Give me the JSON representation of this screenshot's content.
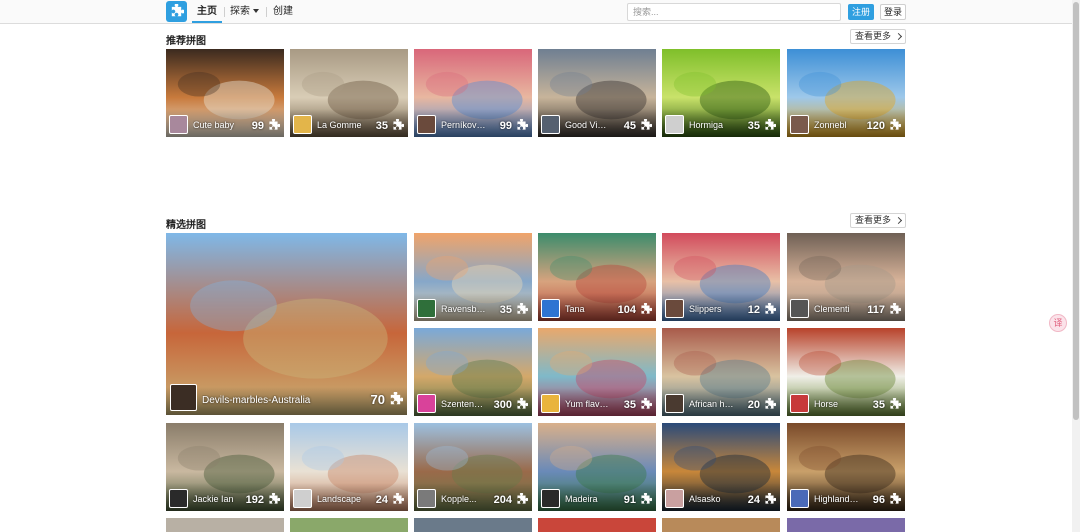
{
  "nav": {
    "home": "主页",
    "explore": "探索",
    "create": "创建",
    "search_placeholder": "搜索...",
    "register": "注册",
    "login": "登录"
  },
  "sections": {
    "recommended_title": "推荐拼图",
    "featured_title": "精选拼图",
    "more_label": "查看更多"
  },
  "recommended": [
    {
      "name": "Cute baby",
      "count": "99",
      "colors": [
        "#3b2a1f",
        "#c87a3c",
        "#e9e2d3"
      ],
      "avatar": "#a8889c"
    },
    {
      "name": "La Gomme",
      "count": "35",
      "colors": [
        "#a89a84",
        "#d9cdb6",
        "#6e5c45"
      ],
      "avatar": "#e3b54a"
    },
    {
      "name": "Perníková s",
      "count": "99",
      "colors": [
        "#d9677a",
        "#e8b7a0",
        "#5b8fd2"
      ],
      "avatar": "#6a4a3c"
    },
    {
      "name": "Good Vibes",
      "count": "45",
      "colors": [
        "#6f7f92",
        "#c7b49a",
        "#3a3430"
      ],
      "avatar": "#556070"
    },
    {
      "name": "Hormiga",
      "count": "35",
      "colors": [
        "#7fbf2a",
        "#c9e26a",
        "#2f5a12"
      ],
      "avatar": "#cfcfcf"
    },
    {
      "name": "Zonnebl",
      "count": "120",
      "colors": [
        "#3d8fd6",
        "#9ec8ea",
        "#e3a621"
      ],
      "avatar": "#7a5a4c"
    }
  ],
  "featured": [
    {
      "name": "Devils-marbles-Australia",
      "count": "70",
      "colors": [
        "#7fb8e8",
        "#c7663a",
        "#c9b377"
      ],
      "avatar": "#3b2d24"
    },
    {
      "name": "Ravensbur...",
      "count": "35",
      "colors": [
        "#f0a46a",
        "#86a7c9",
        "#e6d6b8"
      ],
      "avatar": "#2f6f3a"
    },
    {
      "name": "Tana",
      "count": "104",
      "colors": [
        "#3c8c6c",
        "#d7a37e",
        "#b94a3c"
      ],
      "avatar": "#2e74d2"
    },
    {
      "name": "Slippers",
      "count": "12",
      "colors": [
        "#d24b5c",
        "#e8c0a6",
        "#4a7fc0"
      ],
      "avatar": "#6a4a3c"
    },
    {
      "name": "Clementi",
      "count": "117",
      "colors": [
        "#6f6055",
        "#d9b49a",
        "#a7998a"
      ],
      "avatar": "#555555"
    },
    {
      "name": "Szentend...",
      "count": "300",
      "colors": [
        "#7aa9d9",
        "#d4a86a",
        "#5f7a4a"
      ],
      "avatar": "#d9429a"
    },
    {
      "name": "Yum flavour",
      "count": "35",
      "colors": [
        "#e9a86c",
        "#7fb9c9",
        "#c24a6a"
      ],
      "avatar": "#e9b43c"
    },
    {
      "name": "African ha...",
      "count": "20",
      "colors": [
        "#a85a4a",
        "#d9c3a0",
        "#5a7c8c"
      ],
      "avatar": "#4a3a30"
    },
    {
      "name": "Horse",
      "count": "35",
      "colors": [
        "#b8422a",
        "#f0efe8",
        "#6c8a3a"
      ],
      "avatar": "#c73a3a"
    },
    {
      "name": "Jackie Ian",
      "count": "192",
      "colors": [
        "#8a7d6a",
        "#c9b8a0",
        "#4a5c3a"
      ],
      "avatar": "#2a2a2a"
    },
    {
      "name": "Landscape",
      "count": "24",
      "colors": [
        "#a9c9e8",
        "#e9e1d4",
        "#c98a6a"
      ],
      "avatar": "#cfcfcf"
    },
    {
      "name": "Kopple...",
      "count": "204",
      "colors": [
        "#9cc0e0",
        "#9a6a4a",
        "#6a7a4a"
      ],
      "avatar": "#7a7a7a"
    },
    {
      "name": "Madeira",
      "count": "91",
      "colors": [
        "#d9b08a",
        "#6a8ab8",
        "#3a7a4a"
      ],
      "avatar": "#2a2a2a"
    },
    {
      "name": "Alsasko",
      "count": "24",
      "colors": [
        "#2a4a7a",
        "#c8873a",
        "#1a2a3a"
      ],
      "avatar": "#c9a0a0"
    },
    {
      "name": "Highland C...",
      "count": "96",
      "colors": [
        "#7a4a2a",
        "#c9a06a",
        "#3a2a1a"
      ],
      "avatar": "#4a6ab8"
    }
  ],
  "bottom_row_colors": [
    "#b8b0a4",
    "#8aa86a",
    "#6a7a8a",
    "#c9463a",
    "#b88a5a",
    "#7a6aa8"
  ],
  "side_badge": "译"
}
